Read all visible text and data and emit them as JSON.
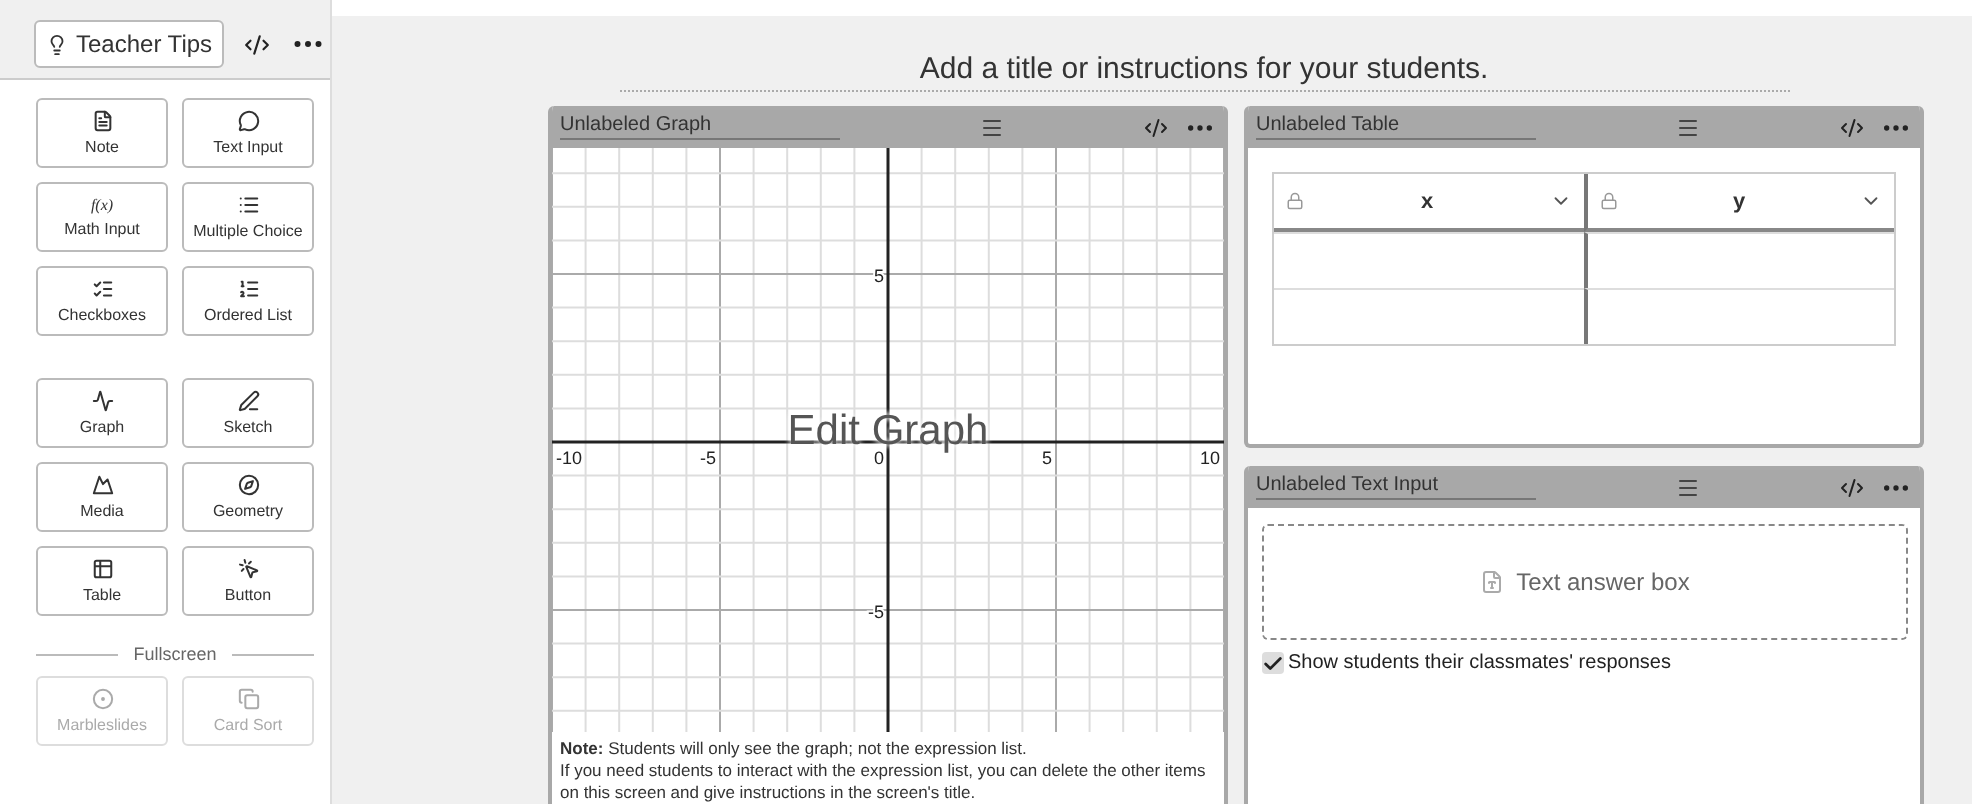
{
  "sidebar": {
    "teacher_tips": "Teacher Tips",
    "groups": [
      {
        "items": [
          {
            "label": "Note",
            "kind": "enabled"
          },
          {
            "label": "Text Input",
            "kind": "enabled"
          },
          {
            "label": "Math Input",
            "kind": "enabled",
            "glyph": "f(x)"
          },
          {
            "label": "Multiple Choice",
            "kind": "enabled"
          },
          {
            "label": "Checkboxes",
            "kind": "enabled"
          },
          {
            "label": "Ordered List",
            "kind": "enabled"
          }
        ]
      },
      {
        "items": [
          {
            "label": "Graph",
            "kind": "enabled"
          },
          {
            "label": "Sketch",
            "kind": "enabled"
          },
          {
            "label": "Media",
            "kind": "enabled"
          },
          {
            "label": "Geometry",
            "kind": "enabled"
          },
          {
            "label": "Table",
            "kind": "enabled"
          },
          {
            "label": "Button",
            "kind": "enabled"
          }
        ]
      },
      {
        "heading": "Fullscreen",
        "items": [
          {
            "label": "Marbleslides",
            "kind": "disabled"
          },
          {
            "label": "Card Sort",
            "kind": "disabled"
          }
        ]
      }
    ]
  },
  "screen_title": "Add a title or instructions for your students.",
  "graph": {
    "title": "Unlabeled Graph",
    "x_ticks": [
      "-10",
      "-5",
      "0",
      "5",
      "10"
    ],
    "y_ticks": [
      "5",
      "-5"
    ],
    "overlay": "Edit Graph",
    "note": [
      "**Note:** Students will only see the graph; not the expression list.",
      "If you need students to interact with the expression list, you can delete the other items on this screen and give instructions in the screen's title."
    ]
  },
  "table": {
    "title": "Unlabeled Table",
    "columns": [
      "x",
      "y"
    ]
  },
  "text_input": {
    "title": "Unlabeled Text Input",
    "answer_box": "Text answer box",
    "show_responses": {
      "label": "Show students their classmates' responses",
      "checked": true
    }
  }
}
